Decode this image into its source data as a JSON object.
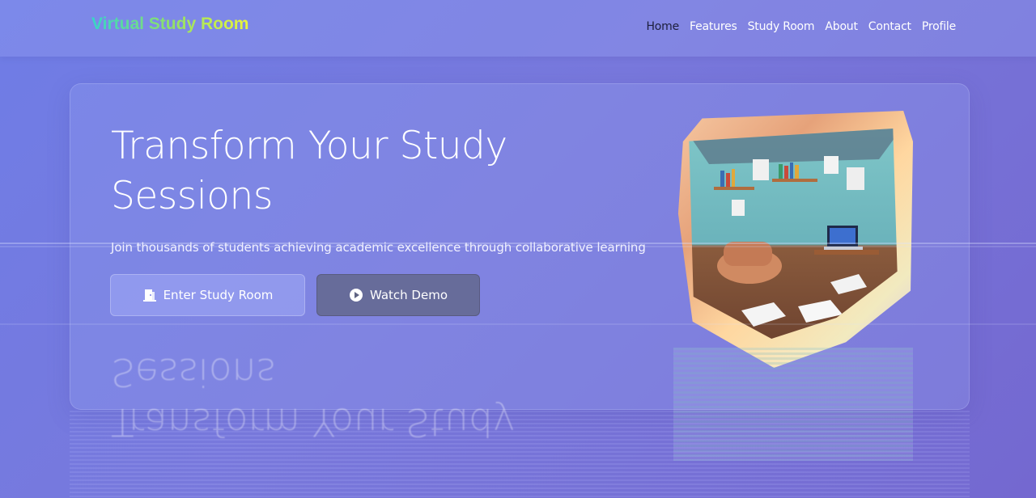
{
  "nav": {
    "brand": "Virtual Study Room",
    "links": [
      {
        "label": "Home",
        "active": true
      },
      {
        "label": "Features"
      },
      {
        "label": "Study Room"
      },
      {
        "label": "About"
      },
      {
        "label": "Contact"
      },
      {
        "label": "Profile"
      }
    ]
  },
  "hero": {
    "title": "Transform Your Study Sessions",
    "subtitle": "Join thousands of students achieving academic excellence through collaborative learning",
    "primary_button": "Enter Study Room",
    "secondary_button": "Watch Demo"
  },
  "icons": {
    "primary_button_icon": "door-icon",
    "secondary_button_icon": "play-circle-icon"
  },
  "colors": {
    "background_start": "#6f7de6",
    "background_end": "#7468d0",
    "brand_gradient_start": "#37d6c6",
    "brand_gradient_end": "#e9f53a",
    "active_link": "#1d1f3d",
    "secondary_button": "#5f6482"
  }
}
